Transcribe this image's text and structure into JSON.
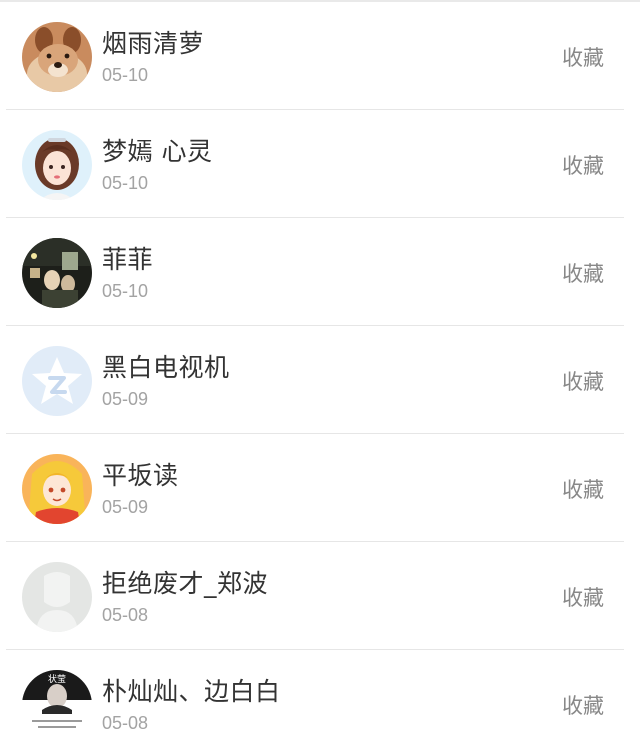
{
  "users": [
    {
      "name": "烟雨清萝",
      "date": "05-10",
      "action": "收藏",
      "avatar": "dog-photo-icon"
    },
    {
      "name": "梦嫣 心灵",
      "date": "05-10",
      "action": "收藏",
      "avatar": "girl-cartoon-icon"
    },
    {
      "name": "菲菲",
      "date": "05-10",
      "action": "收藏",
      "avatar": "night-photo-icon"
    },
    {
      "name": "黑白电视机",
      "date": "05-09",
      "action": "收藏",
      "avatar": "qzone-star-icon"
    },
    {
      "name": "平坂读",
      "date": "05-09",
      "action": "收藏",
      "avatar": "anime-girl-icon"
    },
    {
      "name": "拒绝废才_郑波",
      "date": "05-08",
      "action": "收藏",
      "avatar": "default-person-icon"
    },
    {
      "name": "朴灿灿、边白白",
      "date": "05-08",
      "action": "收藏",
      "avatar": "poster-photo-icon",
      "avatar_text": "状莹"
    }
  ]
}
